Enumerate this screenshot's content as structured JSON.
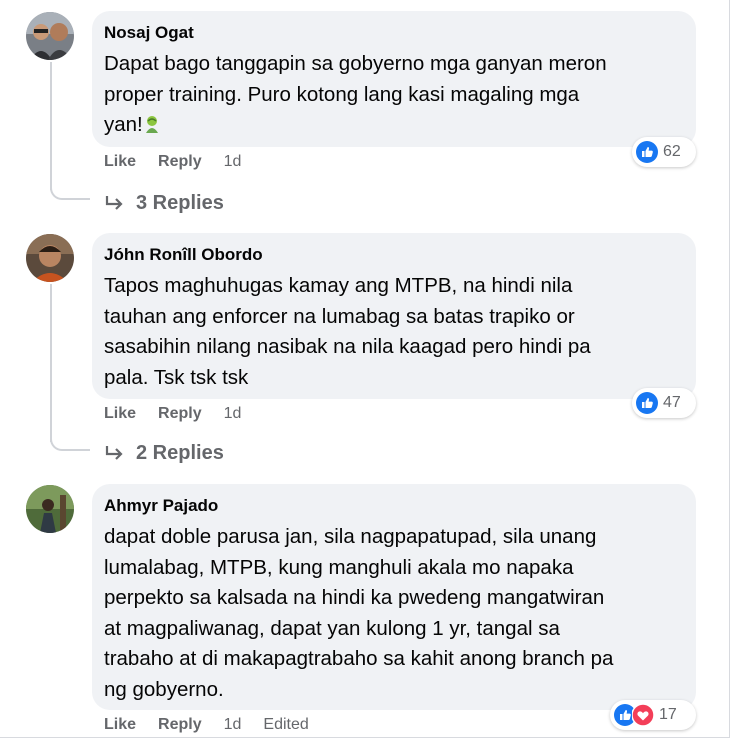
{
  "comments": [
    {
      "author": "Nosaj Ogat",
      "text": "Dapat bago tanggapin sa gobyerno mga ganyan meron\nproper training. Puro kotong lang kasi magaling mga\nyan!",
      "emoji": "man-facepalming-icon",
      "like_label": "Like",
      "reply_label": "Reply",
      "time": "1d",
      "edited": "",
      "reaction_count": "62",
      "reaction_icons": [
        "like-icon"
      ],
      "replies_label": "3 Replies"
    },
    {
      "author": "Jóhn Ronîll Obordo",
      "text": "Tapos maghuhugas kamay ang MTPB, na hindi nila\ntauhan ang enforcer na lumabag sa batas trapiko or\nsasabihin nilang nasibak na nila kaagad pero hindi pa\npala. Tsk tsk tsk",
      "like_label": "Like",
      "reply_label": "Reply",
      "time": "1d",
      "edited": "",
      "reaction_count": "47",
      "reaction_icons": [
        "like-icon"
      ],
      "replies_label": "2 Replies"
    },
    {
      "author": "Ahmyr Pajado",
      "text": "dapat doble parusa jan, sila nagpapatupad, sila unang\nlumalabag, MTPB, kung manghuli akala mo napaka\nperpekto sa kalsada na hindi ka pwedeng mangatwiran\nat magpaliwanag, dapat yan kulong 1 yr, tangal sa\ntrabaho at di makapagtrabaho sa kahit anong branch pa\nng gobyerno.",
      "like_label": "Like",
      "reply_label": "Reply",
      "time": "1d",
      "edited": "Edited",
      "reaction_count": "17",
      "reaction_icons": [
        "like-icon",
        "love-icon"
      ]
    }
  ],
  "colors": {
    "bubble": "#f0f2f5",
    "like_blue": "#1877f2",
    "love_red": "#f33e58",
    "meta_gray": "#65676b"
  }
}
